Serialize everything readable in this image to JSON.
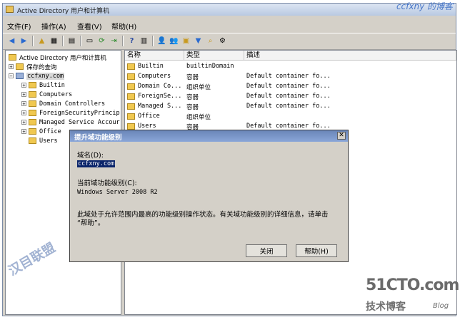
{
  "window": {
    "title": "Active Directory 用户和计算机",
    "watermark_top_right": "ccfxny 的博客"
  },
  "menu": [
    "文件(F)",
    "操作(A)",
    "查看(V)",
    "帮助(H)"
  ],
  "tree": {
    "root": "Active Directory 用户和计算机",
    "saved_queries": "保存的查询",
    "domain": "ccfxny.com",
    "children": [
      "Builtin",
      "Computers",
      "Domain Controllers",
      "ForeignSecurityPrincip",
      "Managed Service Accour",
      "Office",
      "Users"
    ]
  },
  "list": {
    "headers": [
      "名称",
      "类型",
      "描述"
    ],
    "rows": [
      {
        "name": "Builtin",
        "type": "builtinDomain",
        "desc": ""
      },
      {
        "name": "Computers",
        "type": "容器",
        "desc": "Default container fo..."
      },
      {
        "name": "Domain Co...",
        "type": "组织单位",
        "desc": "Default container fo..."
      },
      {
        "name": "ForeignSe...",
        "type": "容器",
        "desc": "Default container fo..."
      },
      {
        "name": "Managed S...",
        "type": "容器",
        "desc": "Default container fo..."
      },
      {
        "name": "Office",
        "type": "组织单位",
        "desc": ""
      },
      {
        "name": "Users",
        "type": "容器",
        "desc": "Default container fo..."
      }
    ]
  },
  "dialog": {
    "title": "提升域功能级别",
    "domain_label": "域名(D):",
    "domain_value": "ccfxny.com",
    "level_label": "当前域功能级别(C):",
    "level_value": "Windows Server 2008 R2",
    "message_line1": "此域处于允许范围内最高的功能级别操作状态。有关域功能级别的详细信息，请单击",
    "message_line2": "“帮助”。",
    "close_button": "关闭",
    "help_button": "帮助(H)"
  },
  "watermarks": {
    "site": "51CTO.com",
    "site_sub": "技术博客",
    "blog": "Blog",
    "left": "汉目联盟"
  }
}
